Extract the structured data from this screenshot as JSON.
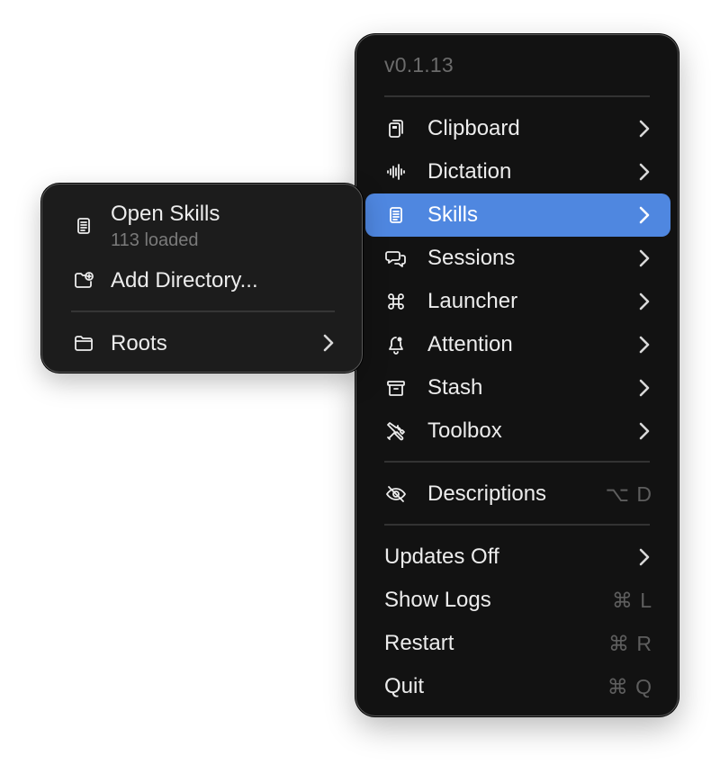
{
  "menu": {
    "version": "v0.1.13",
    "items": [
      {
        "label": "Clipboard",
        "icon": "clipboard-icon"
      },
      {
        "label": "Dictation",
        "icon": "waveform-icon"
      },
      {
        "label": "Skills",
        "icon": "document-icon",
        "active": true
      },
      {
        "label": "Sessions",
        "icon": "chat-bubbles-icon"
      },
      {
        "label": "Launcher",
        "icon": "command-icon"
      },
      {
        "label": "Attention",
        "icon": "bell-badge-icon"
      },
      {
        "label": "Stash",
        "icon": "archive-box-icon"
      },
      {
        "label": "Toolbox",
        "icon": "wrench-screwdriver-icon"
      }
    ],
    "descriptions": {
      "label": "Descriptions",
      "icon": "eye-slash-icon",
      "shortcut": "⌥ D"
    },
    "updates": {
      "label": "Updates Off"
    },
    "show_logs": {
      "label": "Show Logs",
      "shortcut": "⌘ L"
    },
    "restart": {
      "label": "Restart",
      "shortcut": "⌘ R"
    },
    "quit": {
      "label": "Quit",
      "shortcut": "⌘ Q"
    }
  },
  "submenu": {
    "open_skills": {
      "label": "Open Skills",
      "sublabel": "113 loaded",
      "icon": "document-icon"
    },
    "add_directory": {
      "label": "Add Directory...",
      "icon": "folder-plus-icon"
    },
    "roots": {
      "label": "Roots",
      "icon": "folder-icon"
    }
  },
  "colors": {
    "menu_bg": "#121212",
    "submenu_bg": "#1c1c1c",
    "highlight": "#4f87e0",
    "text": "#ececec",
    "muted": "#6b6b6b"
  }
}
